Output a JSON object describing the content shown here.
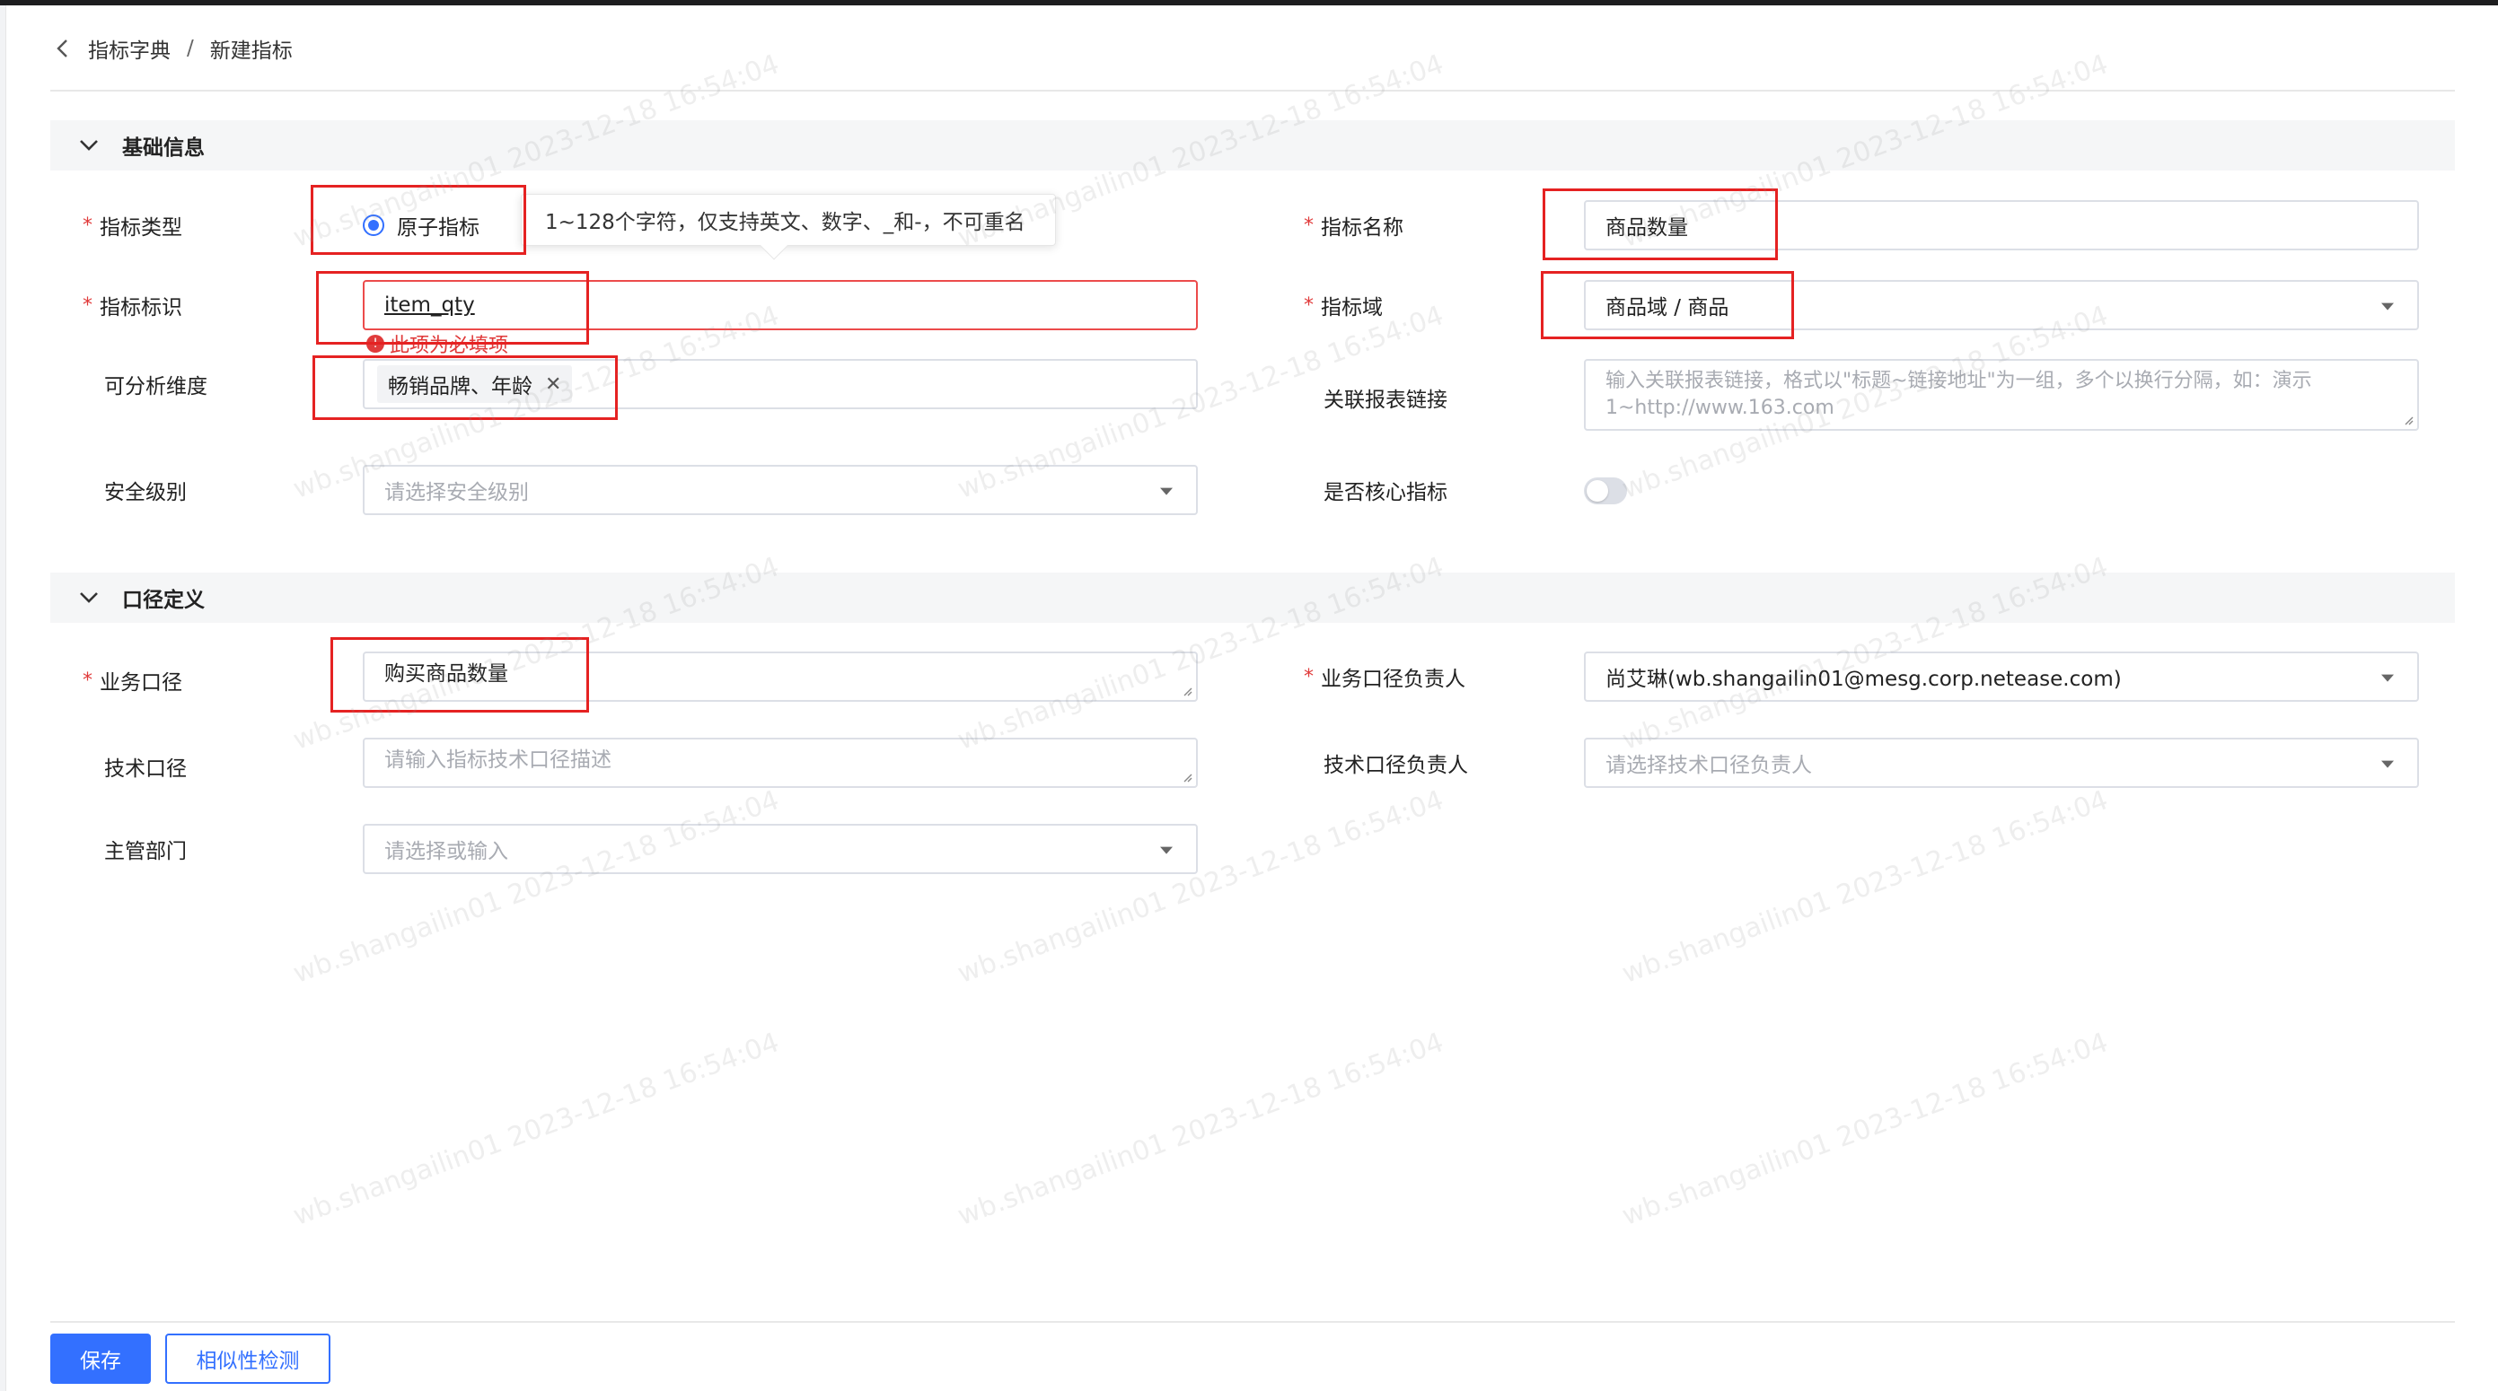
{
  "breadcrumb": {
    "parent": "指标字典",
    "separator": "/",
    "current": "新建指标"
  },
  "sections": {
    "basic": "基础信息",
    "caliber": "口径定义"
  },
  "basic": {
    "indicator_type": {
      "label": "指标类型",
      "option": "原子指标",
      "tooltip": "1~128个字符，仅支持英文、数字、_和-，不可重名"
    },
    "indicator_id": {
      "label": "指标标识",
      "value": "item_qty",
      "error": "此项为必填项"
    },
    "dimensions": {
      "label": "可分析维度",
      "tag": "畅销品牌、年龄"
    },
    "security_level": {
      "label": "安全级别",
      "placeholder": "请选择安全级别"
    },
    "indicator_name": {
      "label": "指标名称",
      "value": "商品数量"
    },
    "indicator_domain": {
      "label": "指标域",
      "value": "商品域 / 商品"
    },
    "report_link": {
      "label": "关联报表链接",
      "placeholder": "输入关联报表链接，格式以\"标题~链接地址\"为一组，多个以换行分隔，如：演示1~http://www.163.com"
    },
    "core_indicator": {
      "label": "是否核心指标"
    }
  },
  "caliber": {
    "business": {
      "label": "业务口径",
      "value": "购买商品数量"
    },
    "technical": {
      "label": "技术口径",
      "placeholder": "请输入指标技术口径描述"
    },
    "department": {
      "label": "主管部门",
      "placeholder": "请选择或输入"
    },
    "business_owner": {
      "label": "业务口径负责人",
      "value": "尚艾琳(wb.shangailin01@mesg.corp.netease.com)"
    },
    "technical_owner": {
      "label": "技术口径负责人",
      "placeholder": "请选择技术口径负责人"
    }
  },
  "footer": {
    "save": "保存",
    "similarity_check": "相似性检测"
  },
  "watermark": "wb.shangailin01 2023-12-18 16:54:04",
  "colors": {
    "accent": "#3370ff",
    "required": "#e03a3a",
    "highlight_box": "#e52222"
  }
}
